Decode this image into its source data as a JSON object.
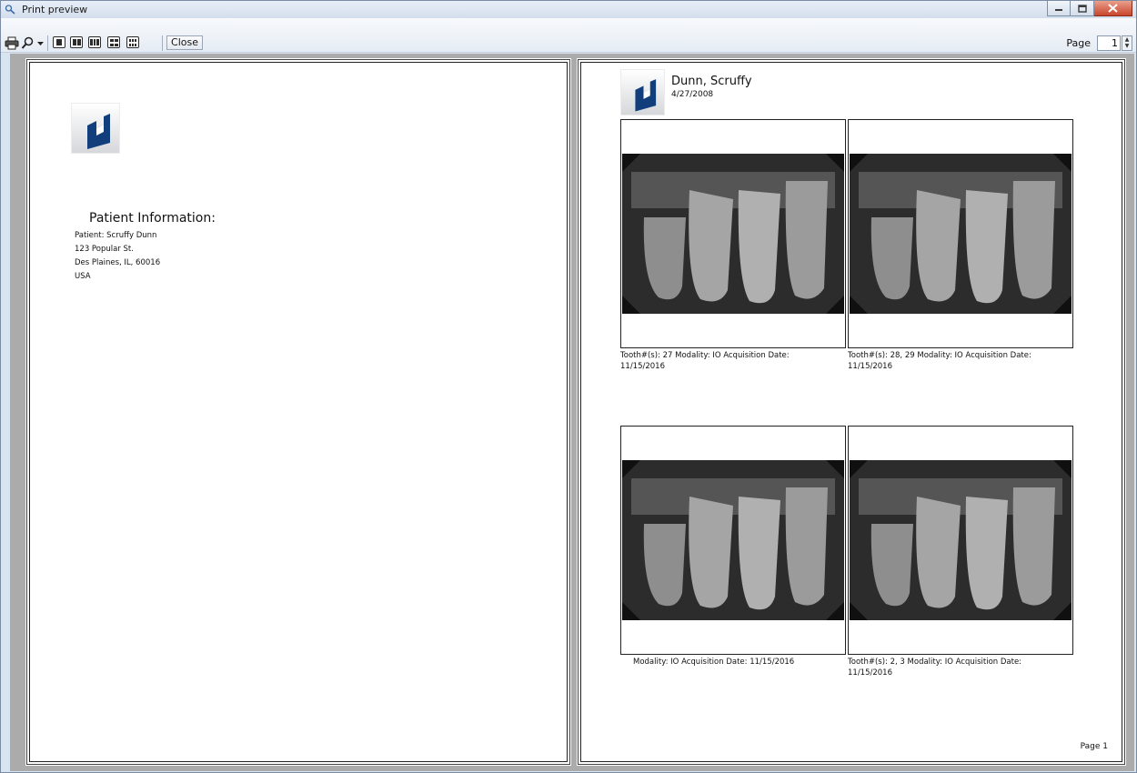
{
  "window": {
    "title": "Print preview"
  },
  "toolbar": {
    "print_icon": "print-icon",
    "zoom_icon": "magnifier-icon",
    "layout_icons": [
      "one-page-icon",
      "two-pages-icon",
      "three-pages-icon",
      "four-pages-icon",
      "six-pages-icon"
    ],
    "close_label": "Close",
    "page_label": "Page",
    "page_value": "1"
  },
  "left_page": {
    "heading": "Patient Information:",
    "lines": [
      "Patient: Scruffy   Dunn",
      "123 Popular St.",
      "Des Plaines, IL, 60016",
      "USA"
    ]
  },
  "right_page": {
    "patient_name": "Dunn, Scruffy",
    "patient_date": "4/27/2008",
    "images": [
      {
        "caption_line1": "Tooth#(s): 27    Modality: IO    Acquisition Date:",
        "caption_line2": "11/15/2016"
      },
      {
        "caption_line1": "Tooth#(s): 28, 29    Modality: IO    Acquisition Date:",
        "caption_line2": "11/15/2016"
      },
      {
        "caption_line1": "Modality: IO    Acquisition Date: 11/15/2016",
        "caption_line2": ""
      },
      {
        "caption_line1": "Tooth#(s): 2, 3    Modality: IO    Acquisition Date:",
        "caption_line2": "11/15/2016"
      }
    ],
    "footer": "Page 1"
  },
  "colors": {
    "logo_blue": "#123f7c",
    "preview_background": "#ababab"
  }
}
